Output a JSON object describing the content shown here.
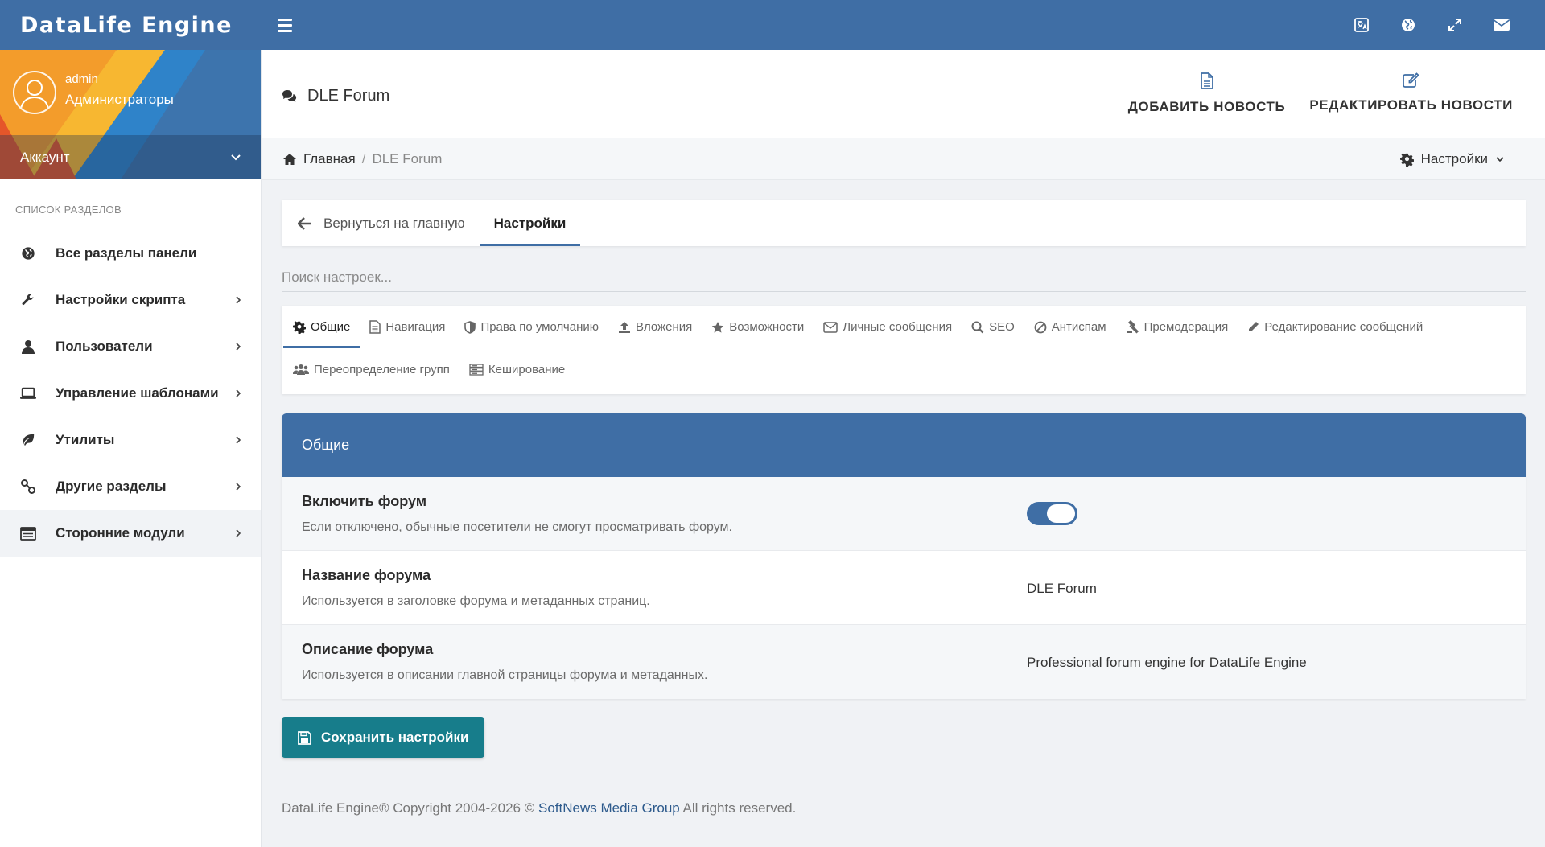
{
  "app": {
    "logo": "DataLife Engine"
  },
  "colors": {
    "primary": "#3f6ea5",
    "save_button": "#177d8b",
    "active_tab_underline": "#3f6ea5"
  },
  "topbar": {
    "icons": [
      "translate-icon",
      "globe-icon",
      "fullscreen-icon",
      "mail-icon"
    ]
  },
  "profile": {
    "username": "admin",
    "group": "Администраторы",
    "account_label": "Аккаунт"
  },
  "sidebar": {
    "title": "СПИСОК РАЗДЕЛОВ",
    "items": [
      {
        "label": "Все разделы панели",
        "icon": "globe-icon",
        "chevron": false
      },
      {
        "label": "Настройки скрипта",
        "icon": "wrench-icon",
        "chevron": true
      },
      {
        "label": "Пользователи",
        "icon": "user-icon",
        "chevron": true
      },
      {
        "label": "Управление шаблонами",
        "icon": "laptop-icon",
        "chevron": true
      },
      {
        "label": "Утилиты",
        "icon": "leaf-icon",
        "chevron": true
      },
      {
        "label": "Другие разделы",
        "icon": "link-icon",
        "chevron": true
      },
      {
        "label": "Сторонние модули",
        "icon": "modules-icon",
        "chevron": true,
        "active": true
      }
    ]
  },
  "header": {
    "title": "DLE Forum",
    "actions": [
      {
        "label": "ДОБАВИТЬ НОВОСТЬ",
        "icon": "document-icon"
      },
      {
        "label": "РЕДАКТИРОВАТЬ НОВОСТИ",
        "icon": "edit-icon"
      }
    ]
  },
  "breadcrumb": {
    "home": "Главная",
    "separator": "/",
    "current": "DLE Forum",
    "settings_label": "Настройки"
  },
  "tabs": {
    "back": "Вернуться на главную",
    "active": "Настройки"
  },
  "search": {
    "placeholder": "Поиск настроек..."
  },
  "subtabs": [
    {
      "label": "Общие",
      "icon": "gear-icon",
      "active": true
    },
    {
      "label": "Навигация",
      "icon": "file-icon"
    },
    {
      "label": "Права по умолчанию",
      "icon": "shield-icon"
    },
    {
      "label": "Вложения",
      "icon": "upload-icon"
    },
    {
      "label": "Возможности",
      "icon": "star-icon"
    },
    {
      "label": "Личные сообщения",
      "icon": "envelope-icon"
    },
    {
      "label": "SEO",
      "icon": "search-icon"
    },
    {
      "label": "Антиспам",
      "icon": "ban-icon"
    },
    {
      "label": "Премодерация",
      "icon": "gavel-icon"
    },
    {
      "label": "Редактирование сообщений",
      "icon": "pencil-icon"
    },
    {
      "label": "Переопределение групп",
      "icon": "users-icon"
    },
    {
      "label": "Кеширование",
      "icon": "server-icon"
    }
  ],
  "panel": {
    "title": "Общие",
    "rows": [
      {
        "title": "Включить форум",
        "description": "Если отключено, обычные посетители не смогут просматривать форум.",
        "type": "toggle",
        "enabled": true
      },
      {
        "title": "Название форума",
        "description": "Используется в заголовке форума и метаданных страниц.",
        "type": "text",
        "value": "DLE Forum"
      },
      {
        "title": "Описание форума",
        "description": "Используется в описании главной страницы форума и метаданных.",
        "type": "text",
        "value": "Professional forum engine for DataLife Engine"
      }
    ]
  },
  "save_button": {
    "label": "Сохранить настройки"
  },
  "footer": {
    "prefix": "DataLife Engine® Copyright 2004-2026 ©",
    "link": "SoftNews Media Group",
    "suffix": "All rights reserved."
  }
}
